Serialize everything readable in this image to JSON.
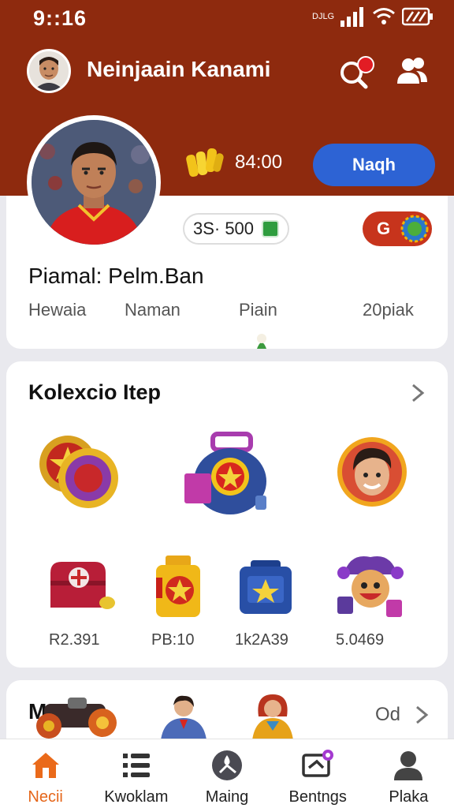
{
  "status": {
    "time": "9::16",
    "network": "DJLG"
  },
  "header": {
    "username": "Neinjaain Kanami",
    "coins": "84:00",
    "primary_button": "Naqh"
  },
  "profile": {
    "pill_value": "3S· 500",
    "red_pill_label": "G",
    "title": "Piamal: Pelm.Ban",
    "stats": [
      "Hewaia",
      "Naman",
      "Piain",
      "20piak"
    ]
  },
  "collection": {
    "title": "Kolexcio Itep",
    "prices": [
      "R2.391",
      "PB:10",
      "1k2A39",
      "5.0469"
    ]
  },
  "bottom_section": {
    "title": "M",
    "more": "Od"
  },
  "nav": [
    {
      "label": "Necii",
      "icon": "home-icon",
      "active": true
    },
    {
      "label": "Kwoklam",
      "icon": "list-icon",
      "active": false
    },
    {
      "label": "Maing",
      "icon": "compass-icon",
      "active": false
    },
    {
      "label": "Bentngs",
      "icon": "cast-icon",
      "active": false
    },
    {
      "label": "Plaka",
      "icon": "profile-icon",
      "active": false
    }
  ],
  "colors": {
    "header": "#8e2a0e",
    "accent": "#e5661a",
    "button": "#2d63d4",
    "red_pill": "#c7341c"
  }
}
